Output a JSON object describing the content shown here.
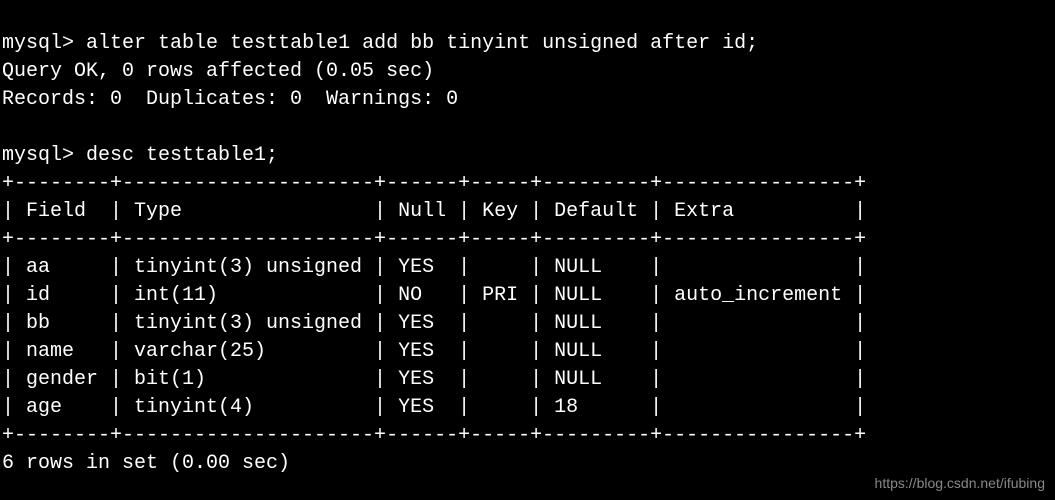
{
  "prompt": "mysql>",
  "command1": "alter table testtable1 add bb tinyint unsigned after id;",
  "result1_line1": "Query OK, 0 rows affected (0.05 sec)",
  "result1_line2": "Records: 0  Duplicates: 0  Warnings: 0",
  "command2": "desc testtable1;",
  "chart_data": {
    "type": "table",
    "columns": [
      "Field",
      "Type",
      "Null",
      "Key",
      "Default",
      "Extra"
    ],
    "rows": [
      {
        "Field": "aa",
        "Type": "tinyint(3) unsigned",
        "Null": "YES",
        "Key": "",
        "Default": "NULL",
        "Extra": ""
      },
      {
        "Field": "id",
        "Type": "int(11)",
        "Null": "NO",
        "Key": "PRI",
        "Default": "NULL",
        "Extra": "auto_increment"
      },
      {
        "Field": "bb",
        "Type": "tinyint(3) unsigned",
        "Null": "YES",
        "Key": "",
        "Default": "NULL",
        "Extra": ""
      },
      {
        "Field": "name",
        "Type": "varchar(25)",
        "Null": "YES",
        "Key": "",
        "Default": "NULL",
        "Extra": ""
      },
      {
        "Field": "gender",
        "Type": "bit(1)",
        "Null": "YES",
        "Key": "",
        "Default": "NULL",
        "Extra": ""
      },
      {
        "Field": "age",
        "Type": "tinyint(4)",
        "Null": "YES",
        "Key": "",
        "Default": "18",
        "Extra": ""
      }
    ]
  },
  "footer": "6 rows in set (0.00 sec)",
  "watermark": "https://blog.csdn.net/ifubing",
  "col_widths": {
    "Field": 8,
    "Type": 21,
    "Null": 6,
    "Key": 5,
    "Default": 9,
    "Extra": 16
  }
}
